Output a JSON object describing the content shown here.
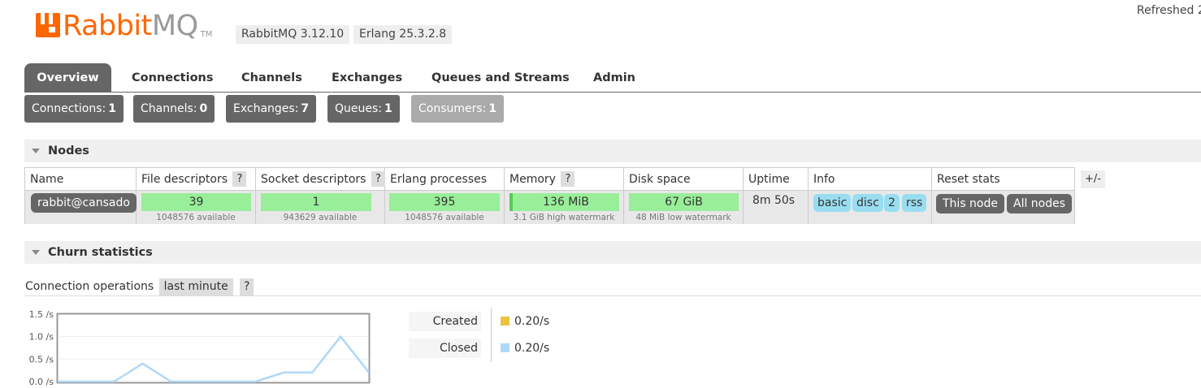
{
  "header": {
    "logo_main": "Rabbit",
    "logo_mq": "MQ",
    "logo_tm": "TM",
    "version_rabbitmq": "RabbitMQ 3.12.10",
    "version_erlang": "Erlang 25.3.2.8",
    "refreshed": "Refreshed 2"
  },
  "tabs": [
    "Overview",
    "Connections",
    "Channels",
    "Exchanges",
    "Queues and Streams",
    "Admin"
  ],
  "active_tab": "Overview",
  "counts": [
    {
      "label": "Connections:",
      "value": "1"
    },
    {
      "label": "Channels:",
      "value": "0"
    },
    {
      "label": "Exchanges:",
      "value": "7"
    },
    {
      "label": "Queues:",
      "value": "1"
    },
    {
      "label": "Consumers:",
      "value": "1"
    }
  ],
  "nodes": {
    "title": "Nodes",
    "headers": {
      "name": "Name",
      "fd": "File descriptors",
      "sd": "Socket descriptors",
      "ep": "Erlang processes",
      "mem": "Memory",
      "disk": "Disk space",
      "uptime": "Uptime",
      "info": "Info",
      "reset": "Reset stats",
      "q": "?"
    },
    "plusminus": "+/-",
    "row": {
      "name": "rabbit@cansado",
      "fd_value": "39",
      "fd_sub": "1048576 available",
      "sd_value": "1",
      "sd_sub": "943629 available",
      "ep_value": "395",
      "ep_sub": "1048576 available",
      "mem_value": "136 MiB",
      "mem_sub": "3.1 GiB high watermark",
      "disk_value": "67 GiB",
      "disk_sub": "48 MiB low watermark",
      "uptime": "8m 50s",
      "info_tags": [
        "basic",
        "disc",
        "2",
        "rss"
      ],
      "reset_this": "This node",
      "reset_all": "All nodes"
    }
  },
  "churn": {
    "title": "Churn statistics",
    "conn_ops_label": "Connection operations",
    "conn_ops_range": "last minute",
    "q": "?",
    "legend": [
      {
        "label": "Created",
        "value": "0.20/s",
        "color": "#edc240"
      },
      {
        "label": "Closed",
        "value": "0.20/s",
        "color": "#afd8f8"
      }
    ]
  },
  "chart_data": {
    "type": "line",
    "y_ticks": [
      "1.5 /s",
      "1.0 /s",
      "0.5 /s",
      "0.0 /s"
    ],
    "ylim": [
      0,
      1.5
    ],
    "x": [
      0,
      1,
      2,
      3,
      4,
      5,
      6,
      7,
      8,
      9,
      10,
      11
    ],
    "series": [
      {
        "name": "Closed",
        "color": "#afd8f8",
        "values": [
          0,
          0,
          0,
          0.4,
          0,
          0,
          0,
          0,
          0.2,
          0.2,
          1.0,
          0.2
        ]
      }
    ]
  }
}
